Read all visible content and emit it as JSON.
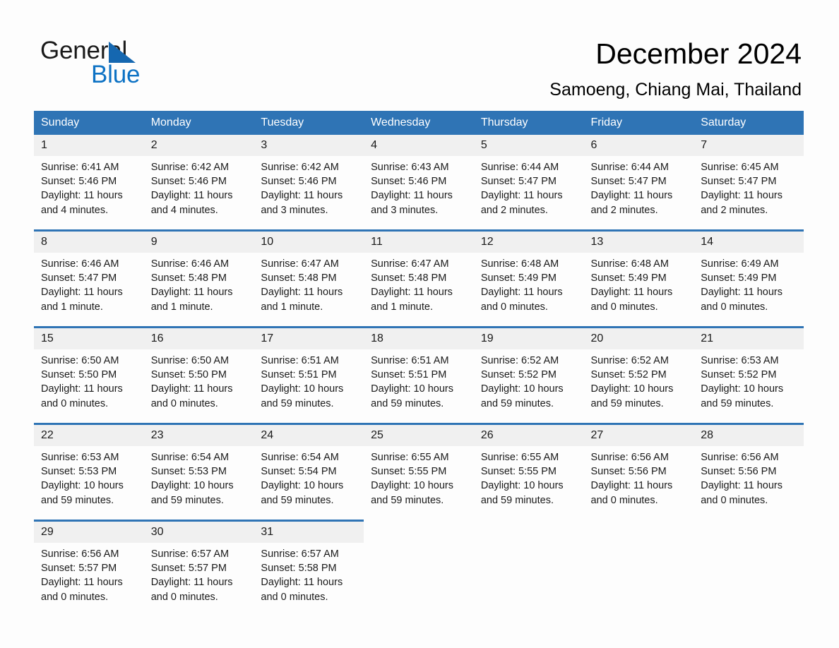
{
  "brand": {
    "name_part1": "General",
    "name_part2": "Blue",
    "triangle_icon": "triangle-icon",
    "accent_color": "#1567b0",
    "blue_text_color": "#0d72c4"
  },
  "header": {
    "title": "December 2024",
    "location": "Samoeng, Chiang Mai, Thailand"
  },
  "calendar": {
    "header_bg_color": "#2f74b5",
    "daynum_bg_color": "#f0f0f0",
    "weekday_headers": [
      "Sunday",
      "Monday",
      "Tuesday",
      "Wednesday",
      "Thursday",
      "Friday",
      "Saturday"
    ],
    "weeks": [
      [
        {
          "day": "1",
          "sunrise": "Sunrise: 6:41 AM",
          "sunset": "Sunset: 5:46 PM",
          "daylight": "Daylight: 11 hours and 4 minutes."
        },
        {
          "day": "2",
          "sunrise": "Sunrise: 6:42 AM",
          "sunset": "Sunset: 5:46 PM",
          "daylight": "Daylight: 11 hours and 4 minutes."
        },
        {
          "day": "3",
          "sunrise": "Sunrise: 6:42 AM",
          "sunset": "Sunset: 5:46 PM",
          "daylight": "Daylight: 11 hours and 3 minutes."
        },
        {
          "day": "4",
          "sunrise": "Sunrise: 6:43 AM",
          "sunset": "Sunset: 5:46 PM",
          "daylight": "Daylight: 11 hours and 3 minutes."
        },
        {
          "day": "5",
          "sunrise": "Sunrise: 6:44 AM",
          "sunset": "Sunset: 5:47 PM",
          "daylight": "Daylight: 11 hours and 2 minutes."
        },
        {
          "day": "6",
          "sunrise": "Sunrise: 6:44 AM",
          "sunset": "Sunset: 5:47 PM",
          "daylight": "Daylight: 11 hours and 2 minutes."
        },
        {
          "day": "7",
          "sunrise": "Sunrise: 6:45 AM",
          "sunset": "Sunset: 5:47 PM",
          "daylight": "Daylight: 11 hours and 2 minutes."
        }
      ],
      [
        {
          "day": "8",
          "sunrise": "Sunrise: 6:46 AM",
          "sunset": "Sunset: 5:47 PM",
          "daylight": "Daylight: 11 hours and 1 minute."
        },
        {
          "day": "9",
          "sunrise": "Sunrise: 6:46 AM",
          "sunset": "Sunset: 5:48 PM",
          "daylight": "Daylight: 11 hours and 1 minute."
        },
        {
          "day": "10",
          "sunrise": "Sunrise: 6:47 AM",
          "sunset": "Sunset: 5:48 PM",
          "daylight": "Daylight: 11 hours and 1 minute."
        },
        {
          "day": "11",
          "sunrise": "Sunrise: 6:47 AM",
          "sunset": "Sunset: 5:48 PM",
          "daylight": "Daylight: 11 hours and 1 minute."
        },
        {
          "day": "12",
          "sunrise": "Sunrise: 6:48 AM",
          "sunset": "Sunset: 5:49 PM",
          "daylight": "Daylight: 11 hours and 0 minutes."
        },
        {
          "day": "13",
          "sunrise": "Sunrise: 6:48 AM",
          "sunset": "Sunset: 5:49 PM",
          "daylight": "Daylight: 11 hours and 0 minutes."
        },
        {
          "day": "14",
          "sunrise": "Sunrise: 6:49 AM",
          "sunset": "Sunset: 5:49 PM",
          "daylight": "Daylight: 11 hours and 0 minutes."
        }
      ],
      [
        {
          "day": "15",
          "sunrise": "Sunrise: 6:50 AM",
          "sunset": "Sunset: 5:50 PM",
          "daylight": "Daylight: 11 hours and 0 minutes."
        },
        {
          "day": "16",
          "sunrise": "Sunrise: 6:50 AM",
          "sunset": "Sunset: 5:50 PM",
          "daylight": "Daylight: 11 hours and 0 minutes."
        },
        {
          "day": "17",
          "sunrise": "Sunrise: 6:51 AM",
          "sunset": "Sunset: 5:51 PM",
          "daylight": "Daylight: 10 hours and 59 minutes."
        },
        {
          "day": "18",
          "sunrise": "Sunrise: 6:51 AM",
          "sunset": "Sunset: 5:51 PM",
          "daylight": "Daylight: 10 hours and 59 minutes."
        },
        {
          "day": "19",
          "sunrise": "Sunrise: 6:52 AM",
          "sunset": "Sunset: 5:52 PM",
          "daylight": "Daylight: 10 hours and 59 minutes."
        },
        {
          "day": "20",
          "sunrise": "Sunrise: 6:52 AM",
          "sunset": "Sunset: 5:52 PM",
          "daylight": "Daylight: 10 hours and 59 minutes."
        },
        {
          "day": "21",
          "sunrise": "Sunrise: 6:53 AM",
          "sunset": "Sunset: 5:52 PM",
          "daylight": "Daylight: 10 hours and 59 minutes."
        }
      ],
      [
        {
          "day": "22",
          "sunrise": "Sunrise: 6:53 AM",
          "sunset": "Sunset: 5:53 PM",
          "daylight": "Daylight: 10 hours and 59 minutes."
        },
        {
          "day": "23",
          "sunrise": "Sunrise: 6:54 AM",
          "sunset": "Sunset: 5:53 PM",
          "daylight": "Daylight: 10 hours and 59 minutes."
        },
        {
          "day": "24",
          "sunrise": "Sunrise: 6:54 AM",
          "sunset": "Sunset: 5:54 PM",
          "daylight": "Daylight: 10 hours and 59 minutes."
        },
        {
          "day": "25",
          "sunrise": "Sunrise: 6:55 AM",
          "sunset": "Sunset: 5:55 PM",
          "daylight": "Daylight: 10 hours and 59 minutes."
        },
        {
          "day": "26",
          "sunrise": "Sunrise: 6:55 AM",
          "sunset": "Sunset: 5:55 PM",
          "daylight": "Daylight: 10 hours and 59 minutes."
        },
        {
          "day": "27",
          "sunrise": "Sunrise: 6:56 AM",
          "sunset": "Sunset: 5:56 PM",
          "daylight": "Daylight: 11 hours and 0 minutes."
        },
        {
          "day": "28",
          "sunrise": "Sunrise: 6:56 AM",
          "sunset": "Sunset: 5:56 PM",
          "daylight": "Daylight: 11 hours and 0 minutes."
        }
      ],
      [
        {
          "day": "29",
          "sunrise": "Sunrise: 6:56 AM",
          "sunset": "Sunset: 5:57 PM",
          "daylight": "Daylight: 11 hours and 0 minutes."
        },
        {
          "day": "30",
          "sunrise": "Sunrise: 6:57 AM",
          "sunset": "Sunset: 5:57 PM",
          "daylight": "Daylight: 11 hours and 0 minutes."
        },
        {
          "day": "31",
          "sunrise": "Sunrise: 6:57 AM",
          "sunset": "Sunset: 5:58 PM",
          "daylight": "Daylight: 11 hours and 0 minutes."
        },
        {
          "day": "",
          "sunrise": "",
          "sunset": "",
          "daylight": ""
        },
        {
          "day": "",
          "sunrise": "",
          "sunset": "",
          "daylight": ""
        },
        {
          "day": "",
          "sunrise": "",
          "sunset": "",
          "daylight": ""
        },
        {
          "day": "",
          "sunrise": "",
          "sunset": "",
          "daylight": ""
        }
      ]
    ]
  }
}
